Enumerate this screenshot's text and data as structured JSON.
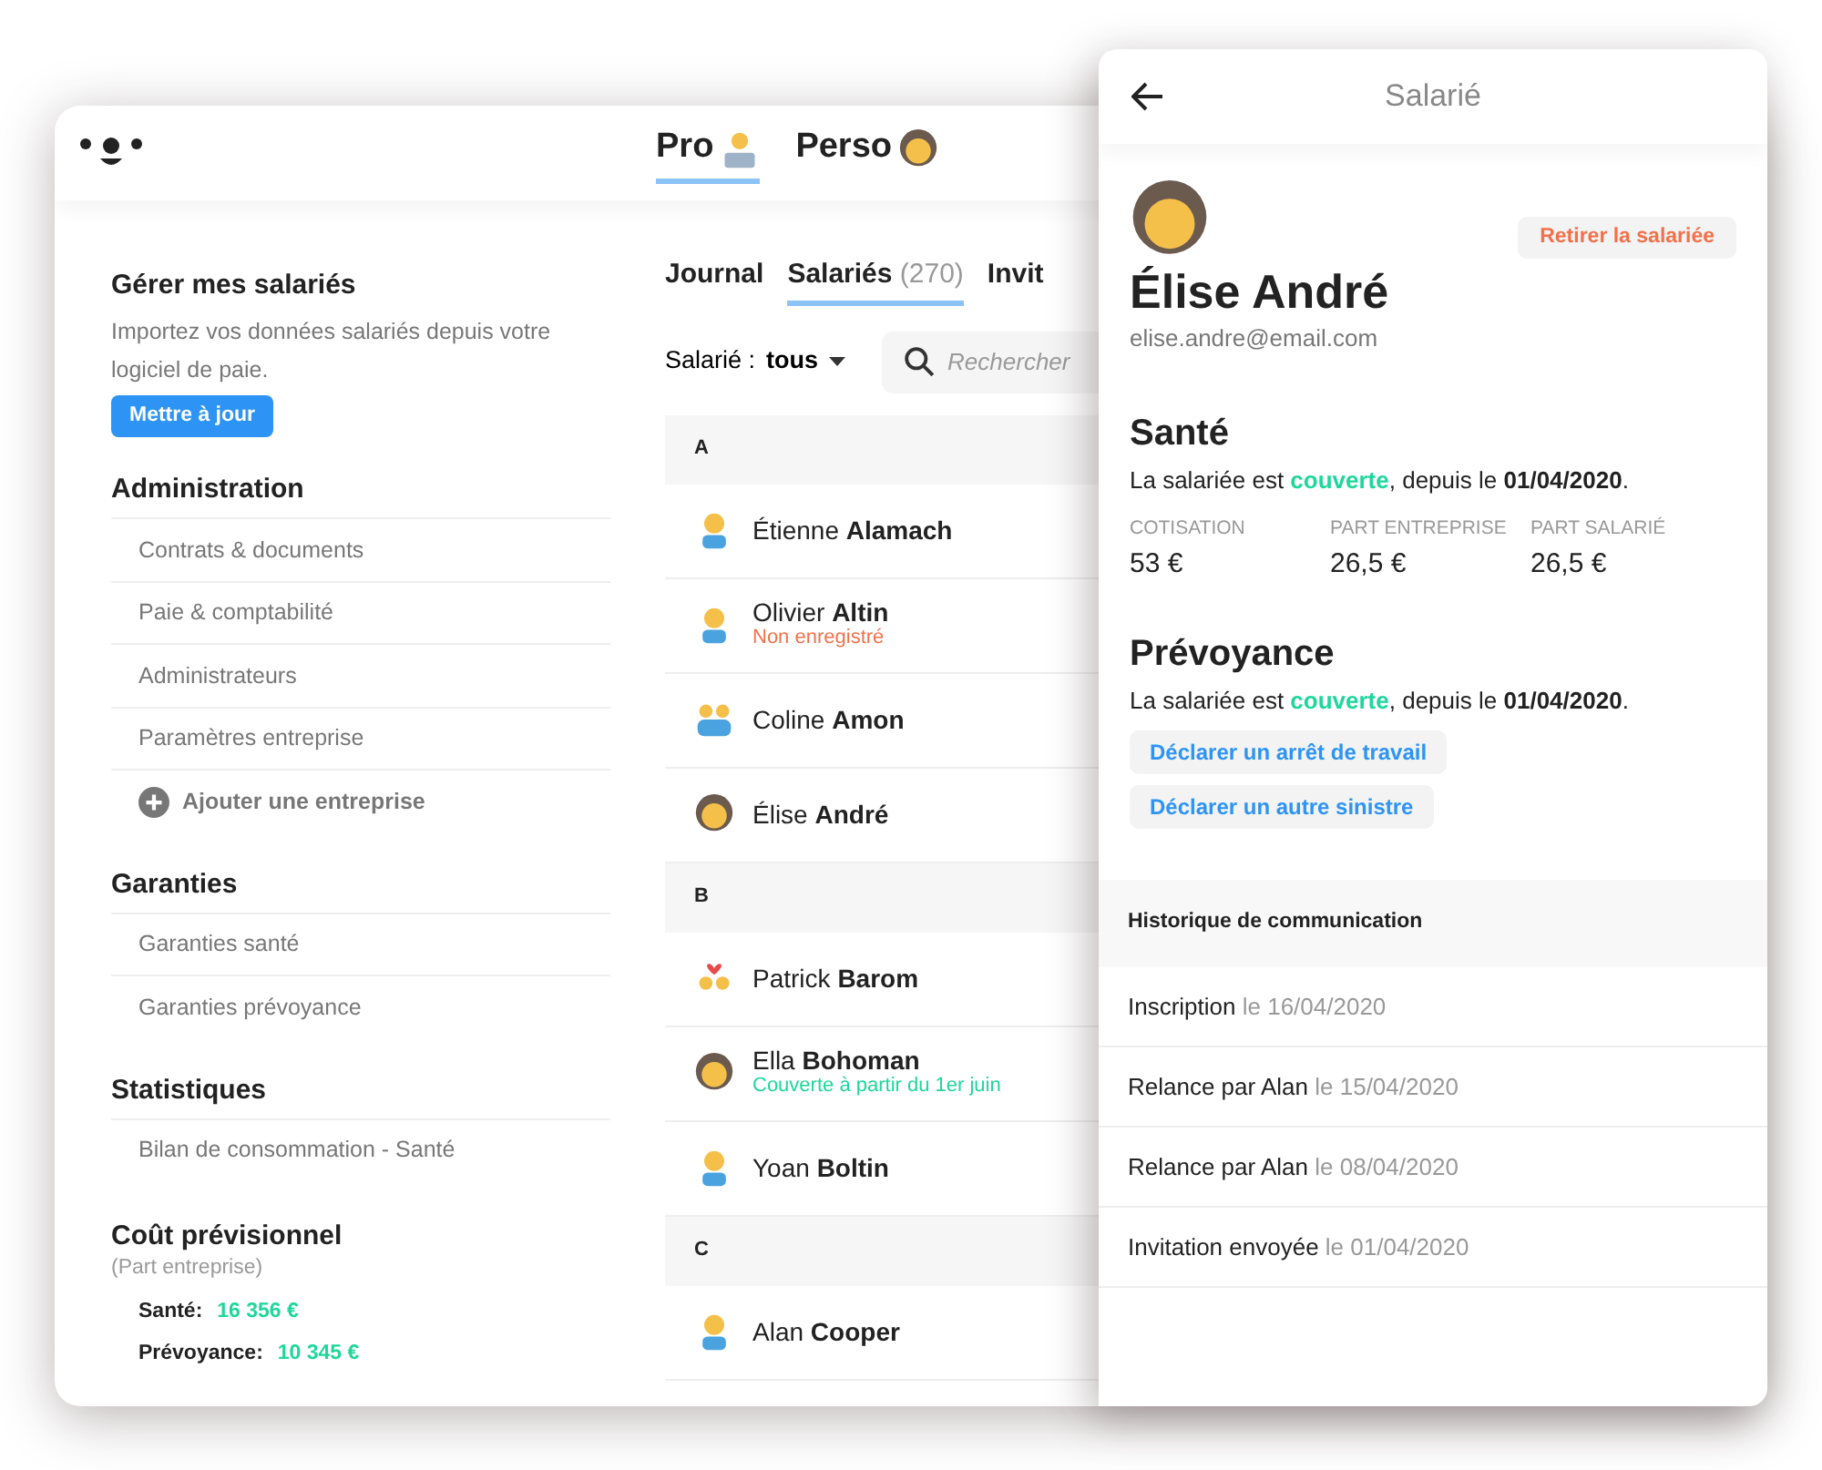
{
  "header": {
    "tabs": [
      {
        "label": "Pro",
        "kind": "worker",
        "selected": true
      },
      {
        "label": "Perso",
        "kind": "woman",
        "selected": false
      }
    ]
  },
  "sidebar": {
    "intro": {
      "title": "Gérer mes salariés",
      "description": "Importez vos données salariés depuis votre logiciel de paie.",
      "button": "Mettre à jour"
    },
    "sections": [
      {
        "title": "Administration",
        "items": [
          "Contrats & documents",
          "Paie & comptabilité",
          "Administrateurs",
          "Paramètres entreprise"
        ],
        "action": "Ajouter une entreprise"
      },
      {
        "title": "Garanties",
        "items": [
          "Garanties santé",
          "Garanties prévoyance"
        ]
      },
      {
        "title": "Statistiques",
        "items": [
          "Bilan de consommation - Santé"
        ]
      }
    ],
    "cost": {
      "title": "Coût prévisionnel",
      "subtitle": "(Part entreprise)",
      "lines": [
        {
          "label": "Santé:",
          "value": "16 356 €"
        },
        {
          "label": "Prévoyance:",
          "value": "10 345 €"
        }
      ]
    }
  },
  "main": {
    "tabs": [
      {
        "label": "Journal",
        "selected": false
      },
      {
        "label": "Salariés",
        "count": "(270)",
        "selected": true
      },
      {
        "label": "Invit",
        "selected": false
      }
    ],
    "filter": {
      "label": "Salarié :",
      "value": "tous"
    },
    "search": {
      "placeholder": "Rechercher"
    },
    "groups": [
      {
        "letter": "A",
        "employees": [
          {
            "name": "Étienne **Alamach**",
            "kind": "man"
          },
          {
            "name": "Olivier **Altin**",
            "kind": "man",
            "status": {
              "text": "Non enregistré",
              "kind": "warning"
            }
          },
          {
            "name": "Coline **Amon**",
            "kind": "family"
          },
          {
            "name": "Élise **André**",
            "kind": "woman"
          }
        ]
      },
      {
        "letter": "B",
        "employees": [
          {
            "name": "Patrick **Barom**",
            "kind": "couple"
          },
          {
            "name": "Ella **Bohoman**",
            "kind": "woman",
            "status": {
              "text": "Couverte à partir du 1er juin",
              "kind": "success"
            }
          },
          {
            "name": "Yoan **Boltin**",
            "kind": "man"
          }
        ]
      },
      {
        "letter": "C",
        "employees": [
          {
            "name": "Alan **Cooper**",
            "kind": "man"
          }
        ]
      }
    ]
  },
  "panel": {
    "title": "Salarié",
    "remove_button": "Retirer la salariée",
    "name": "Élise André",
    "email": "elise.andre@email.com",
    "sante": {
      "title": "Santé",
      "before": "La salariée est ",
      "status": "couverte",
      "after": ", depuis le **01/04/2020**.",
      "stats": [
        {
          "label": "COTISATION",
          "value": "53 €"
        },
        {
          "label": "PART ENTREPRISE",
          "value": "26,5 €"
        },
        {
          "label": "PART SALARIÉ",
          "value": "26,5 €"
        }
      ]
    },
    "prevoyance": {
      "title": "Prévoyance",
      "before": "La salariée est ",
      "status": "couverte",
      "after": ", depuis le **01/04/2020**.",
      "buttons": [
        "Déclarer un arrêt de travail",
        "Déclarer un autre sinistre"
      ]
    },
    "history": {
      "title": "Historique de communication",
      "items": [
        {
          "event": "Inscription",
          "date": "le 16/04/2020"
        },
        {
          "event": "Relance par Alan",
          "date": "le 15/04/2020"
        },
        {
          "event": "Relance par Alan",
          "date": "le 08/04/2020"
        },
        {
          "event": "Invitation envoyée",
          "date": "le 01/04/2020"
        }
      ]
    }
  }
}
